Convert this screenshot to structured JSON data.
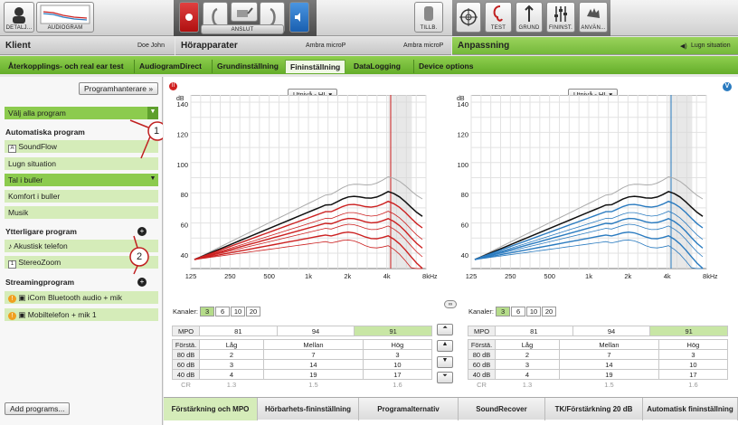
{
  "toolbar": {
    "detail_label": "DETALJ...",
    "audiogram_label": "AUDIOGRAM",
    "connect_label": "ANSLUT",
    "tillb_label": "TILLB.",
    "test_label": "TEST",
    "grund_label": "GRUND",
    "fininst_label": "FININST.",
    "anvan_label": "ANVÄN..."
  },
  "header": {
    "klient_title": "Klient",
    "klient_name": "Doe John",
    "horapparater_title": "Hörapparater",
    "device_left": "Ambra microP",
    "device_right": "Ambra microP",
    "anpassning_title": "Anpassning",
    "program_situation": "Lugn situation"
  },
  "tabs": [
    "Återkopplings- och real ear test",
    "AudiogramDirect",
    "Grundinställning",
    "Fininställning",
    "DataLogging",
    "Device options"
  ],
  "left": {
    "program_manager_label": "Programhanterare »",
    "select_all": "Välj alla program",
    "auto_heading": "Automatiska program",
    "auto_programs": [
      "SoundFlow",
      "Lugn situation",
      "Tal i buller",
      "Komfort i buller",
      "Musik"
    ],
    "extra_heading": "Ytterligare program",
    "extra_programs": [
      "Akustisk telefon",
      "StereoZoom"
    ],
    "stream_heading": "Streamingprogram",
    "stream_programs": [
      "iCom Bluetooth audio + mik",
      "Mobiltelefon + mik 1"
    ],
    "add_programs": "Add programs...",
    "callout1": "1",
    "callout2": "2"
  },
  "charts": {
    "dropdown_left": "Utnivå - HL",
    "dropdown_right": "Utnivå - HL",
    "y_unit": "dB",
    "x_unit": "Hz",
    "y_ticks": [
      "140",
      "120",
      "100",
      "80",
      "60",
      "40"
    ],
    "x_ticks": [
      "125",
      "250",
      "500",
      "1k",
      "2k",
      "4k",
      "8k"
    ]
  },
  "controls": {
    "channels_label": "Kanaler:",
    "channels": [
      "3",
      "6",
      "10",
      "20"
    ],
    "mpo_label": "MPO",
    "forsta_label": "Förstä.",
    "cr_label": "CR",
    "col_headers": [
      "Låg",
      "Mellan",
      "Hög"
    ],
    "left_mpo": [
      "81",
      "94",
      "91"
    ],
    "right_mpo": [
      "81",
      "94",
      "91"
    ],
    "rows": [
      {
        "label": "80 dB",
        "left": [
          "2",
          "7",
          "3"
        ],
        "right": [
          "2",
          "7",
          "3"
        ]
      },
      {
        "label": "60 dB",
        "left": [
          "3",
          "14",
          "10"
        ],
        "right": [
          "3",
          "14",
          "10"
        ]
      },
      {
        "label": "40 dB",
        "left": [
          "4",
          "19",
          "17"
        ],
        "right": [
          "4",
          "19",
          "17"
        ]
      }
    ],
    "cr_left": [
      "1.3",
      "1.5",
      "1.6"
    ],
    "cr_right": [
      "1.3",
      "1.5",
      "1.6"
    ]
  },
  "bottom_tabs": [
    "Förstärkning och MPO",
    "Hörbarhets-fininställning",
    "Programalternativ",
    "SoundRecover",
    "TK/Förstärkning 20 dB",
    "Automatisk fininställning"
  ],
  "colors": {
    "left_ear": "#cc2020",
    "right_ear": "#2a7bc0",
    "accent": "#7dc242"
  }
}
